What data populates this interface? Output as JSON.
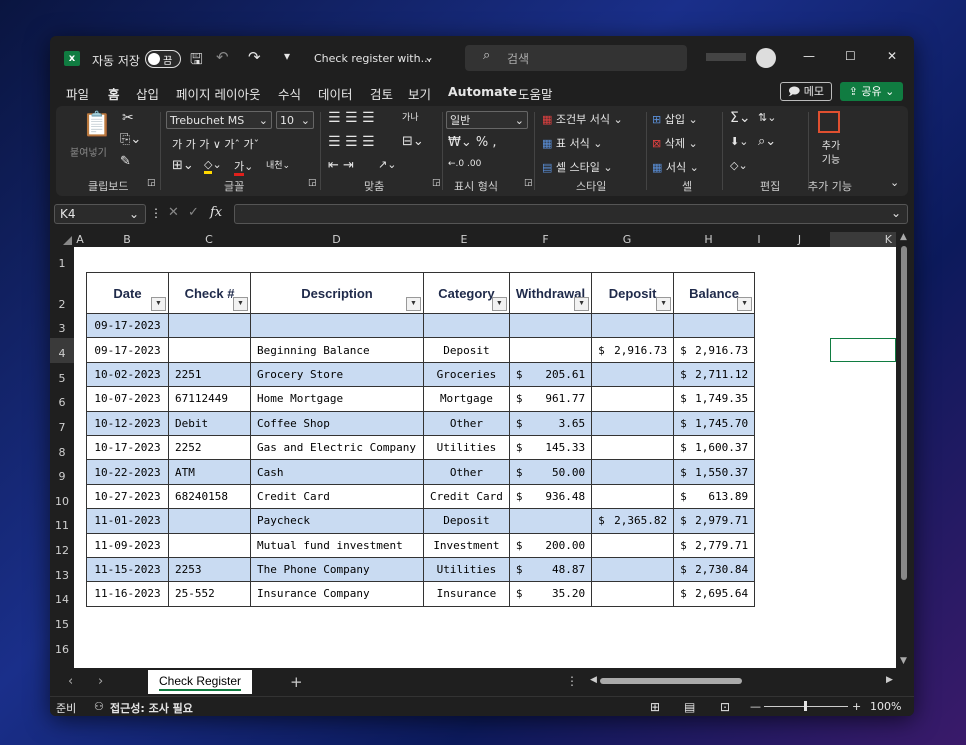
{
  "titlebar": {
    "autosave_label": "자동 저장",
    "autosave_state": "끔",
    "doc_title": "Check register with...",
    "search_placeholder": "검색",
    "minimize": "—",
    "maximize": "☐",
    "close": "✕"
  },
  "menu": {
    "items": [
      "파일",
      "홈",
      "삽입",
      "페이지 레이아웃",
      "수식",
      "데이터",
      "검토",
      "보기",
      "Automate",
      "도움말"
    ],
    "active": "홈",
    "memo_label": "메모",
    "share_label": "공유"
  },
  "ribbon": {
    "clipboard": {
      "paste": "붙여넣기",
      "group": "클립보드"
    },
    "font": {
      "family": "Trebuchet MS",
      "size": "10",
      "row2": "가  가  가 ∨  가ˆ  가ˇ",
      "group": "글꼴"
    },
    "align": {
      "group": "맞춤"
    },
    "number": {
      "format": "일반",
      "group": "표시 형식"
    },
    "styles": {
      "cond": "조건부 서식",
      "table": "표 서식",
      "cell": "셀 스타일",
      "group": "스타일"
    },
    "cells": {
      "insert": "삽입",
      "delete": "삭제",
      "format": "서식",
      "group": "셀"
    },
    "edit": {
      "group": "편집"
    },
    "addins": {
      "label": "추가 기능",
      "group": "추가 기능"
    }
  },
  "formula_bar": {
    "name_box": "K4",
    "fx": "fx",
    "value": ""
  },
  "columns": [
    "A",
    "B",
    "C",
    "D",
    "E",
    "F",
    "G",
    "H",
    "I",
    "J",
    "K"
  ],
  "rows": [
    "1",
    "2",
    "3",
    "4",
    "5",
    "6",
    "7",
    "8",
    "9",
    "10",
    "11",
    "12",
    "13",
    "14",
    "15",
    "16"
  ],
  "table": {
    "headers": [
      "Date",
      "Check #",
      "Description",
      "Category",
      "Withdrawal",
      "Deposit",
      "Balance"
    ],
    "rows": [
      {
        "date": "09-17-2023",
        "check": "",
        "desc": "",
        "cat": "",
        "wd_sym": "",
        "wd": "",
        "dep_sym": "",
        "dep": "",
        "bal_sym": "",
        "bal": ""
      },
      {
        "date": "09-17-2023",
        "check": "",
        "desc": "Beginning Balance",
        "cat": "Deposit",
        "wd_sym": "",
        "wd": "",
        "dep_sym": "$",
        "dep": "2,916.73",
        "bal_sym": "$",
        "bal": "2,916.73"
      },
      {
        "date": "10-02-2023",
        "check": "2251",
        "desc": "Grocery Store",
        "cat": "Groceries",
        "wd_sym": "$",
        "wd": "205.61",
        "dep_sym": "",
        "dep": "",
        "bal_sym": "$",
        "bal": "2,711.12"
      },
      {
        "date": "10-07-2023",
        "check": "67112449",
        "desc": "Home Mortgage",
        "cat": "Mortgage",
        "wd_sym": "$",
        "wd": "961.77",
        "dep_sym": "",
        "dep": "",
        "bal_sym": "$",
        "bal": "1,749.35"
      },
      {
        "date": "10-12-2023",
        "check": "Debit",
        "desc": "Coffee Shop",
        "cat": "Other",
        "wd_sym": "$",
        "wd": "3.65",
        "dep_sym": "",
        "dep": "",
        "bal_sym": "$",
        "bal": "1,745.70"
      },
      {
        "date": "10-17-2023",
        "check": "2252",
        "desc": "Gas and Electric Company",
        "cat": "Utilities",
        "wd_sym": "$",
        "wd": "145.33",
        "dep_sym": "",
        "dep": "",
        "bal_sym": "$",
        "bal": "1,600.37"
      },
      {
        "date": "10-22-2023",
        "check": "ATM",
        "desc": "Cash",
        "cat": "Other",
        "wd_sym": "$",
        "wd": "50.00",
        "dep_sym": "",
        "dep": "",
        "bal_sym": "$",
        "bal": "1,550.37"
      },
      {
        "date": "10-27-2023",
        "check": "68240158",
        "desc": "Credit Card",
        "cat": "Credit Card",
        "wd_sym": "$",
        "wd": "936.48",
        "dep_sym": "",
        "dep": "",
        "bal_sym": "$",
        "bal": "613.89"
      },
      {
        "date": "11-01-2023",
        "check": "",
        "desc": "Paycheck",
        "cat": "Deposit",
        "wd_sym": "",
        "wd": "",
        "dep_sym": "$",
        "dep": "2,365.82",
        "bal_sym": "$",
        "bal": "2,979.71"
      },
      {
        "date": "11-09-2023",
        "check": "",
        "desc": "Mutual fund investment",
        "cat": "Investment",
        "wd_sym": "$",
        "wd": "200.00",
        "dep_sym": "",
        "dep": "",
        "bal_sym": "$",
        "bal": "2,779.71"
      },
      {
        "date": "11-15-2023",
        "check": "2253",
        "desc": "The Phone Company",
        "cat": "Utilities",
        "wd_sym": "$",
        "wd": "48.87",
        "dep_sym": "",
        "dep": "",
        "bal_sym": "$",
        "bal": "2,730.84"
      },
      {
        "date": "11-16-2023",
        "check": "25-552",
        "desc": "Insurance Company",
        "cat": "Insurance",
        "wd_sym": "$",
        "wd": "35.20",
        "dep_sym": "",
        "dep": "",
        "bal_sym": "$",
        "bal": "2,695.64"
      }
    ]
  },
  "tabs": {
    "sheet": "Check Register",
    "add": "+"
  },
  "status": {
    "ready": "준비",
    "accessibility": "접근성: 조사 필요",
    "zoom": "100%"
  },
  "colors": {
    "accent": "#107c41",
    "band": "#c9dbf2",
    "header_text": "#1f2a4a"
  }
}
